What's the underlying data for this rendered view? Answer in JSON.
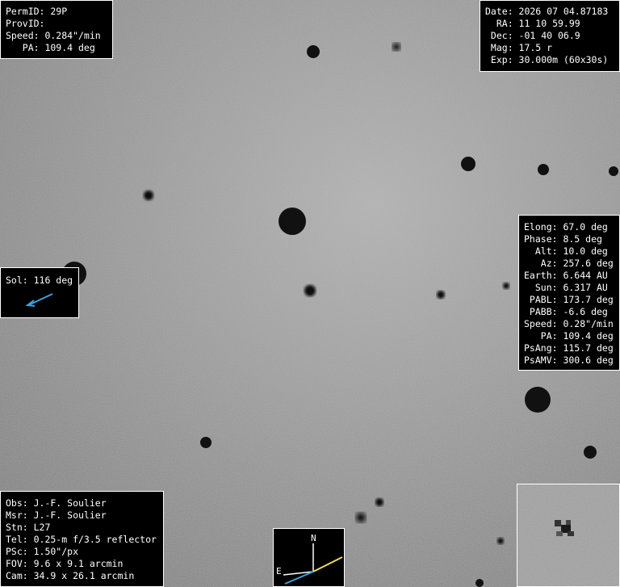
{
  "top_left": {
    "perm_id": "PermID: 29P",
    "prov_id": "ProvID:",
    "speed": "Speed: 0.284\"/min",
    "pa": "   PA: 109.4 deg"
  },
  "top_right": {
    "date": "Date: 2026 07 04.87183",
    "ra": "  RA: 11 10 59.99",
    "dec": " Dec: -01 40 06.9",
    "mag": " Mag: 17.5 r",
    "exp": " Exp: 30.000m (60x30s)"
  },
  "sol": {
    "label": "Sol: 116 deg",
    "arrow_color": "#3aa0e0"
  },
  "ephemeris": {
    "elong": "Elong: 67.0 deg",
    "phase": "Phase: 8.5 deg",
    "alt": "  Alt: 10.0 deg",
    "az": "   Az: 257.6 deg",
    "earth": "Earth: 6.644 AU",
    "sun": "  Sun: 6.317 AU",
    "pabl": " PABL: 173.7 deg",
    "pabb": " PABB: -6.6 deg",
    "speed": "Speed: 0.28\"/min",
    "pa": "   PA: 109.4 deg",
    "psang": "PsAng: 115.7 deg",
    "psamv": "PsAMV: 300.6 deg"
  },
  "observer": {
    "obs": "Obs: J.-F. Soulier",
    "msr": "Msr: J.-F. Soulier",
    "stn": "Stn: L27",
    "tel": "Tel: 0.25-m f/3.5 reflector",
    "psc": "PSc: 1.50\"/px",
    "fov": "FOV: 9.6 x 9.1 arcmin",
    "cam": "Cam: 34.9 x 26.1 arcmin"
  },
  "compass": {
    "north_label": "N",
    "east_label": "E",
    "blue_color": "#3aa0e0",
    "yellow_color": "#f0e040"
  },
  "colors": {
    "sky": "#8c8c8c",
    "panel_bg": "#000000",
    "panel_text": "#ffffff"
  }
}
